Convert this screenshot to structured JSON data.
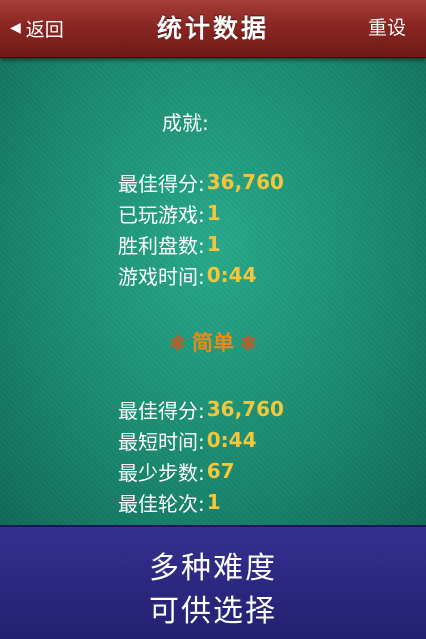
{
  "nav": {
    "back_label": "返回",
    "title": "统计数据",
    "reset_label": "重设"
  },
  "achievements": {
    "heading": "成就:",
    "stats": [
      {
        "label": "最佳得分:",
        "value": "36,760"
      },
      {
        "label": "已玩游戏:",
        "value": "1"
      },
      {
        "label": "胜利盘数:",
        "value": "1"
      },
      {
        "label": "游戏时间:",
        "value": "0:44"
      }
    ]
  },
  "easy": {
    "title": "简单",
    "stats": [
      {
        "label": "最佳得分:",
        "value": "36,760"
      },
      {
        "label": "最短时间:",
        "value": "0:44"
      },
      {
        "label": "最少步数:",
        "value": "67"
      },
      {
        "label": "最佳轮次:",
        "value": "1"
      }
    ]
  },
  "banner": {
    "line1": "多种难度",
    "line2": "可供选择"
  },
  "colors": {
    "navbar": "#8a2622",
    "felt": "#1a8a70",
    "value_gold": "#f4c63c",
    "section_orange": "#e98a1c",
    "banner_blue": "#2c2880"
  },
  "icons": {
    "back": "left-triangle-arrow-icon",
    "ornament": "flourish-ornament-icon"
  }
}
